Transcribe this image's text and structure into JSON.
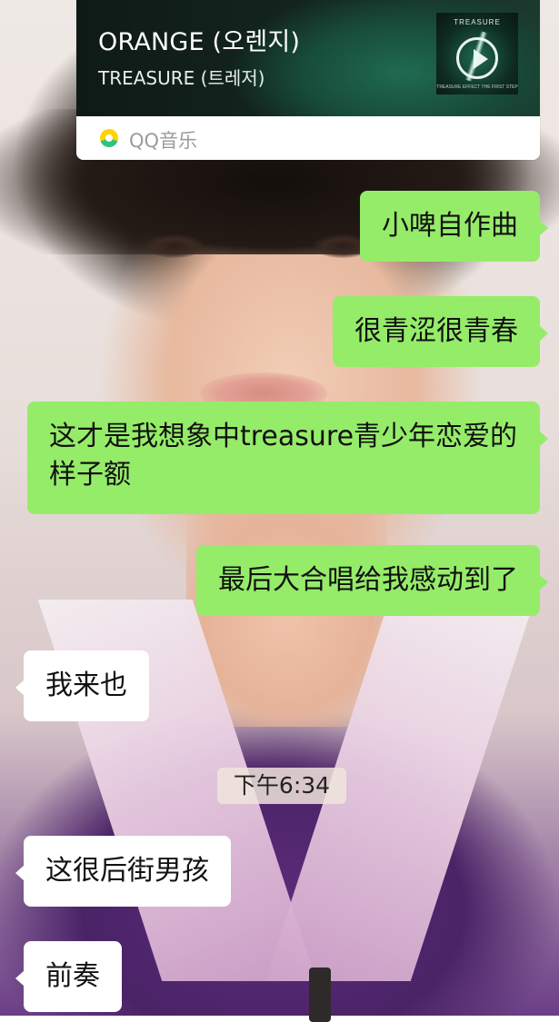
{
  "music_card": {
    "title": "ORANGE (오렌지)",
    "artist": "TREASURE (트레저)",
    "album_label": "TREASURE",
    "album_fine_print": "TREASURE EFFECT THE FIRST STEP",
    "source_app": "QQ音乐",
    "icon": "qq-music-icon"
  },
  "messages": [
    {
      "direction": "out",
      "text": "小啤自作曲"
    },
    {
      "direction": "out",
      "text": "很青涩很青春"
    },
    {
      "direction": "out",
      "text": "这才是我想象中treasure青少年恋爱的样子额"
    },
    {
      "direction": "out",
      "text": "最后大合唱给我感动到了"
    },
    {
      "direction": "in",
      "text": "我来也"
    },
    {
      "direction": "in",
      "text": "这很后街男孩"
    },
    {
      "direction": "in",
      "text": "前奏"
    }
  ],
  "timestamp": "下午6:34",
  "colors": {
    "outgoing_bubble": "#95ec69",
    "incoming_bubble": "#ffffff",
    "card_band": "#142720"
  }
}
